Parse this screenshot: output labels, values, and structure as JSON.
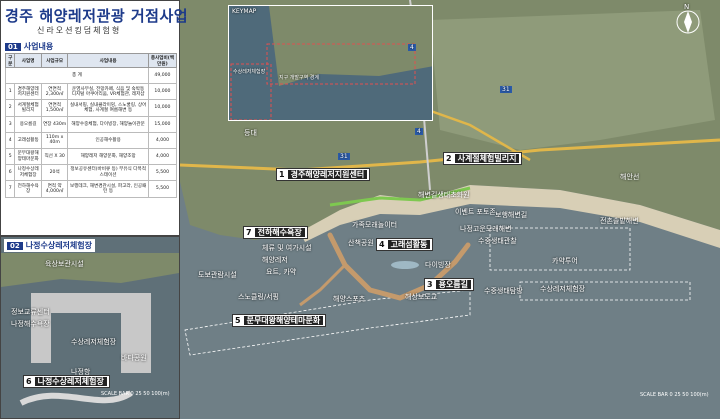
{
  "title": "경주 해양레저관광 거점사업",
  "subtitle": "신라오션킹덤체험형",
  "section1": {
    "num": "01",
    "title": "사업내용"
  },
  "table": {
    "headers": [
      "구분",
      "사업명",
      "사업규모",
      "사업내용",
      "총사업비(백만원)"
    ],
    "total": {
      "label": "총 계",
      "value": "49,000"
    },
    "rows": [
      {
        "no": "1",
        "name": "경주해양레저지원센터",
        "scale": "연면적 2,300㎡",
        "content": "운영사무실, 전망카페, 식음 및 숙박동 디지털 아쿠아리움, VR체험관, 레저샵",
        "cost": "10,000"
      },
      {
        "no": "2",
        "name": "서계절체험빌리지",
        "scale": "연면적 1,500㎡",
        "content": "실내서핑, 실내클라이밍, 스노쿨링, 상어체험, 사계절 여름해변 등",
        "cost": "10,000"
      },
      {
        "no": "3",
        "name": "용오름길",
        "scale": "연장 430m",
        "content": "해양수중체험, 다이빙장, 해양놀이관문",
        "cost": "15,000"
      },
      {
        "no": "4",
        "name": "고래섬활동",
        "scale": "110m x 40m",
        "content": "인공해수활용",
        "cost": "4,000"
      },
      {
        "no": "5",
        "name": "문무대왕해양테마문화",
        "scale": "직선 X 30",
        "content": "해양레저 해양문화, 해양조망",
        "cost": "4,000"
      },
      {
        "no": "6",
        "name": "나정수상레저체험장",
        "scale": "20석",
        "content": "정보공유센터(바비큐 등) 부유식 다목적스테이션",
        "cost": "5,500"
      },
      {
        "no": "7",
        "name": "전하해수욕장",
        "scale": "면적 약 4,000㎡",
        "content": "보행데크, 해변경관시설, 파고라, 인공패턴 등",
        "cost": "5,500"
      }
    ]
  },
  "section2": {
    "num": "02",
    "title": "나정수상레저체험장"
  },
  "inset": {
    "labels": [
      "육상보관시설",
      "정보교류센터",
      "나정해수욕장",
      "수상레저체험장",
      "바다공원",
      "나정항"
    ],
    "zone": {
      "num": "6",
      "text": "나정수상레저체험장"
    }
  },
  "keymap": {
    "label": "KEYMAP",
    "places": [
      "수상레저체험장",
      "지구 개발구역 경계"
    ]
  },
  "zones": [
    {
      "num": "1",
      "text": "경주해양레저지원센터"
    },
    {
      "num": "2",
      "text": "사계절체험빌리지"
    },
    {
      "num": "3",
      "text": "용오름길"
    },
    {
      "num": "4",
      "text": "고래섬활동"
    },
    {
      "num": "5",
      "text": "문무대왕해양테마문화"
    },
    {
      "num": "7",
      "text": "전하해수욕장"
    }
  ],
  "map_labels": [
    "이벤트 포토존",
    "가족모래놀이터",
    "산책공원",
    "해변길생태초화원",
    "수중생태관찰",
    "수상레저체험장",
    "보행해변길",
    "나정고운모래해변",
    "전촌솔밭해변",
    "체류 및 여가시설",
    "해양레저",
    "요트, 카약",
    "다이빙장",
    "해상보도교",
    "카약투어",
    "도보관람시설",
    "스노클링/서핑",
    "해양스포츠",
    "수중생태탐방",
    "해안선",
    "등대"
  ],
  "road_numbers": [
    "4",
    "31",
    "4",
    "31"
  ],
  "north": "N",
  "scale_bars": [
    {
      "label": "SCALE BAR",
      "ticks": [
        "0",
        "25",
        "50",
        "100(m)"
      ]
    },
    {
      "label": "SCALE BAR",
      "ticks": [
        "0",
        "25",
        "50",
        "100(m)"
      ]
    }
  ],
  "colors": {
    "accent": "#1d3a8a",
    "sea": "#6f7f86",
    "land": "#7c8a6a",
    "route": "#c4b49a",
    "zoneBox": "#222222"
  }
}
